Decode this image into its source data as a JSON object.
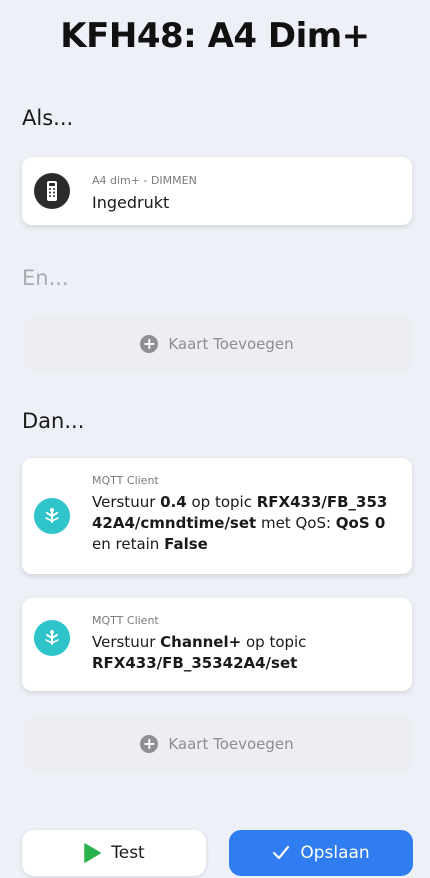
{
  "header": {
    "title": "KFH48: A4 Dim+"
  },
  "sections": {
    "if_label": "Als...",
    "and_label": "En...",
    "then_label": "Dan..."
  },
  "trigger_card": {
    "icon": "remote-control-icon",
    "device": "A4 dim+ - DIMMEN",
    "event": "Ingedrukt"
  },
  "add_card": {
    "label": "Kaart Toevoegen"
  },
  "actions": [
    {
      "icon": "mqtt-icon",
      "source": "MQTT Client",
      "p1": "Verstuur ",
      "v1": "0.4",
      "p2": " op topic ",
      "v2": "RFX433/FB_35342A4/cmndtime/set",
      "p3": " met QoS: ",
      "v3": "QoS 0",
      "p4": " en retain ",
      "v4": "False"
    },
    {
      "icon": "mqtt-icon",
      "source": "MQTT Client",
      "p1": "Verstuur ",
      "v1": "Channel+",
      "p2": " op topic ",
      "v2": "RFX433/FB_35342A4/set"
    }
  ],
  "buttons": {
    "test_label": "Test",
    "save_label": "Opslaan"
  },
  "colors": {
    "background": "#eef0f7",
    "accent_blue": "#2f7df0",
    "mqtt_teal": "#2ec4c9",
    "play_green": "#2bb24c",
    "trigger_icon_bg": "#2b2b2b"
  }
}
